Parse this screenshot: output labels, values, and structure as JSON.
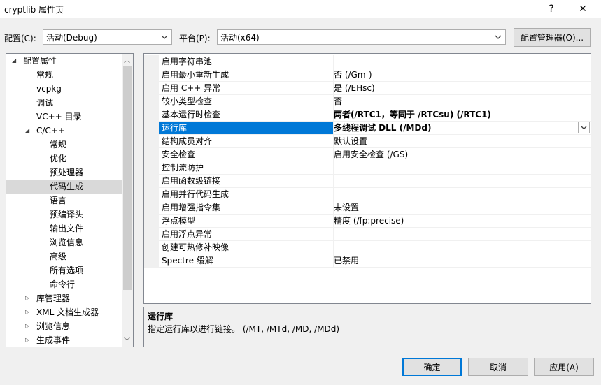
{
  "window": {
    "title": "cryptlib 属性页",
    "help_button": "?",
    "close_button": "✕"
  },
  "toolbar": {
    "config_label": "配置(C):",
    "config_value": "活动(Debug)",
    "platform_label": "平台(P):",
    "platform_value": "活动(x64)",
    "config_manager_label": "配置管理器(O)..."
  },
  "tree": {
    "items": [
      {
        "label": "配置属性",
        "expander": "◢"
      },
      {
        "label": "常规"
      },
      {
        "label": "vcpkg"
      },
      {
        "label": "调试"
      },
      {
        "label": "VC++ 目录"
      },
      {
        "label": "C/C++",
        "expander": "◢"
      },
      {
        "label": "常规"
      },
      {
        "label": "优化"
      },
      {
        "label": "预处理器"
      },
      {
        "label": "代码生成"
      },
      {
        "label": "语言"
      },
      {
        "label": "预编译头"
      },
      {
        "label": "输出文件"
      },
      {
        "label": "浏览信息"
      },
      {
        "label": "高级"
      },
      {
        "label": "所有选项"
      },
      {
        "label": "命令行"
      },
      {
        "label": "库管理器",
        "expander": "▷"
      },
      {
        "label": "XML 文档生成器",
        "expander": "▷"
      },
      {
        "label": "浏览信息",
        "expander": "▷"
      },
      {
        "label": "生成事件",
        "expander": "▷"
      }
    ],
    "selected_index": 9,
    "scroll_up": "︿",
    "scroll_down": "﹀"
  },
  "properties": {
    "rows": [
      {
        "name": "启用字符串池",
        "value": ""
      },
      {
        "name": "启用最小重新生成",
        "value": "否 (/Gm-)"
      },
      {
        "name": "启用 C++ 异常",
        "value": "是 (/EHsc)"
      },
      {
        "name": "较小类型检查",
        "value": "否"
      },
      {
        "name": "基本运行时检查",
        "value": "两者(/RTC1，等同于 /RTCsu) (/RTC1)",
        "bold": true
      },
      {
        "name": "运行库",
        "value": "多线程调试 DLL (/MDd)",
        "bold": true,
        "selected": true
      },
      {
        "name": "结构成员对齐",
        "value": "默认设置"
      },
      {
        "name": "安全检查",
        "value": "启用安全检查 (/GS)"
      },
      {
        "name": "控制流防护",
        "value": ""
      },
      {
        "name": "启用函数级链接",
        "value": ""
      },
      {
        "name": "启用并行代码生成",
        "value": ""
      },
      {
        "name": "启用增强指令集",
        "value": "未设置"
      },
      {
        "name": "浮点模型",
        "value": "精度 (/fp:precise)"
      },
      {
        "name": "启用浮点异常",
        "value": ""
      },
      {
        "name": "创建可热修补映像",
        "value": ""
      },
      {
        "name": "Spectre 缓解",
        "value": "已禁用"
      }
    ]
  },
  "description": {
    "title": "运行库",
    "text": "指定运行库以进行链接。     (/MT, /MTd, /MD, /MDd)"
  },
  "footer": {
    "ok_label": "确定",
    "cancel_label": "取消",
    "apply_label": "应用(A)"
  },
  "colors": {
    "selection": "#0078d7",
    "tree_selection": "#d9d9d9",
    "default_border": "#0078d7"
  }
}
